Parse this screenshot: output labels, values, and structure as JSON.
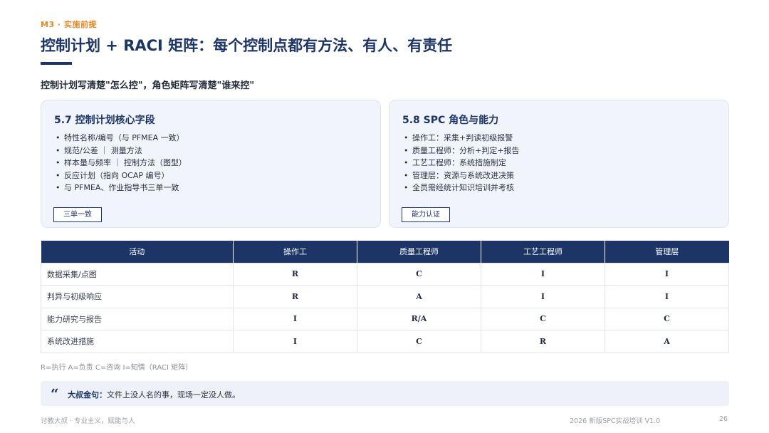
{
  "eyebrow": "M3 · 实施前提",
  "title": "控制计划 + RACI 矩阵：每个控制点都有方法、有人、有责任",
  "subtitle": "控制计划写清楚\"怎么控\"，角色矩阵写清楚\"谁来控\"",
  "cards": [
    {
      "title": "5.7 控制计划核心字段",
      "items": [
        "特性名称/编号（与 PFMEA 一致）",
        "规范/公差 ｜ 测量方法",
        "样本量与频率 ｜ 控制方法（图型）",
        "反应计划（指向 OCAP 编号）",
        "与 PFMEA、作业指导书三单一致"
      ],
      "tag": "三单一致"
    },
    {
      "title": "5.8 SPC 角色与能力",
      "items": [
        "操作工：采集+判读初级报警",
        "质量工程师：分析+判定+报告",
        "工艺工程师：系统措施制定",
        "管理层：资源与系统改进决策",
        "全员需经统计知识培训并考核"
      ],
      "tag": "能力认证"
    }
  ],
  "table": {
    "headers": [
      "活动",
      "操作工",
      "质量工程师",
      "工艺工程师",
      "管理层"
    ],
    "rows": [
      [
        "数据采集/点图",
        "R",
        "C",
        "I",
        "I"
      ],
      [
        "判异与初级响应",
        "R",
        "A",
        "I",
        "I"
      ],
      [
        "能力研究与报告",
        "I",
        "R/A",
        "C",
        "C"
      ],
      [
        "系统改进措施",
        "I",
        "C",
        "R",
        "A"
      ]
    ]
  },
  "legend": "R=执行 A=负责 C=咨询 I=知情（RACI 矩阵）",
  "quote": {
    "icon": "quote-icon",
    "label": "大叔金句：",
    "text": "文件上没人名的事，现场一定没人做。"
  },
  "footer": {
    "left": "讨教大叔 · 专业主义，赋能与人",
    "right": "2026 新版SPC实战培训 V1.0",
    "page": "26"
  }
}
